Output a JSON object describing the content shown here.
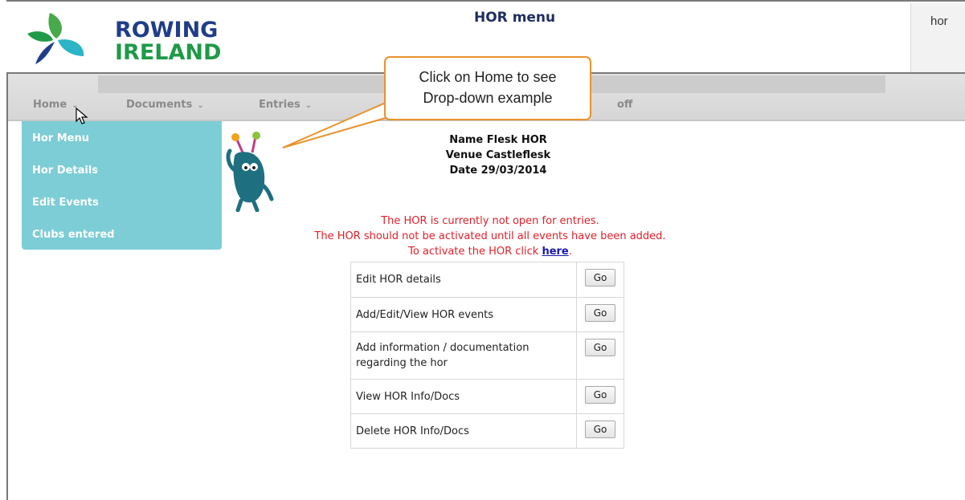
{
  "header": {
    "logo_line1": "ROWING",
    "logo_line2": "IRELAND",
    "title": "HOR menu",
    "user": "hor"
  },
  "nav": {
    "items": [
      {
        "label": "Home"
      },
      {
        "label": "Documents"
      },
      {
        "label": "Entries"
      },
      {
        "label": "off"
      }
    ]
  },
  "dropdown": {
    "items": [
      {
        "label": "Hor Menu"
      },
      {
        "label": "Hor Details"
      },
      {
        "label": "Edit Events"
      },
      {
        "label": "Clubs entered"
      }
    ]
  },
  "callout": {
    "line1": "Click on Home to see",
    "line2": "Drop-down example"
  },
  "info": {
    "name": "Name Flesk HOR",
    "venue": "Venue Castleflesk",
    "date": "Date 29/03/2014"
  },
  "message": {
    "line1": "The HOR is currently not open for entries.",
    "line2": "The HOR should not be activated until all events have been added.",
    "line3_prefix": "To activate the HOR click ",
    "line3_link": "here",
    "line3_suffix": "."
  },
  "actions": {
    "rows": [
      {
        "label": "Edit HOR details",
        "button": "Go"
      },
      {
        "label": "Add/Edit/View HOR events",
        "button": "Go"
      },
      {
        "label": "Add information / documentation regarding the hor",
        "button": "Go"
      },
      {
        "label": "View HOR Info/Docs",
        "button": "Go"
      },
      {
        "label": "Delete HOR Info/Docs",
        "button": "Go"
      }
    ]
  },
  "colors": {
    "dropdown_bg": "#7ccdd5",
    "warning_text": "#e0202a",
    "callout_border": "#e8932e",
    "logo_blue": "#1f3d8a",
    "logo_green": "#1f9a48"
  }
}
